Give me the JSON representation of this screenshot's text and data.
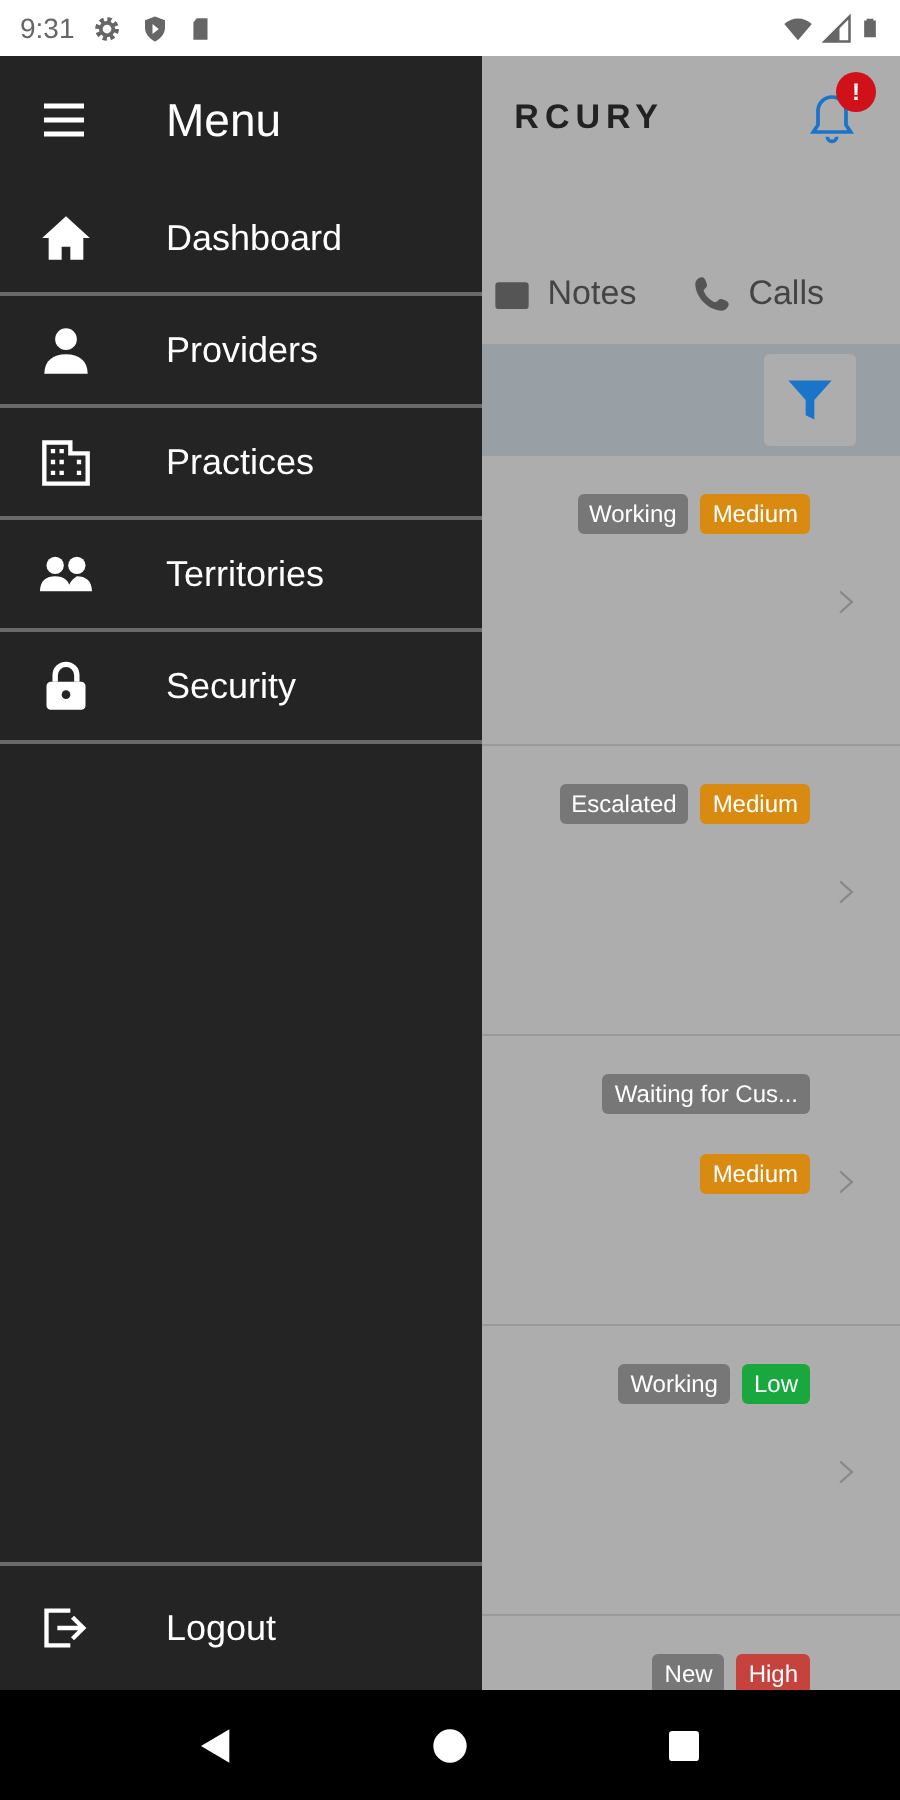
{
  "status_bar": {
    "time": "9:31"
  },
  "drawer": {
    "title": "Menu",
    "items": [
      {
        "label": "Dashboard"
      },
      {
        "label": "Providers"
      },
      {
        "label": "Practices"
      },
      {
        "label": "Territories"
      },
      {
        "label": "Security"
      }
    ],
    "footer_item": {
      "label": "Logout"
    }
  },
  "app": {
    "logo": "RCURY",
    "notification_badge": "!",
    "tabs": [
      {
        "label": "Notes"
      },
      {
        "label": "Calls"
      }
    ],
    "issues": [
      {
        "badges": [
          {
            "text": "Working",
            "color": "#777777"
          },
          {
            "text": "Medium",
            "color": "#d98a10"
          }
        ],
        "chevron": true
      },
      {
        "badges": [
          {
            "text": "Escalated",
            "color": "#777777"
          },
          {
            "text": "Medium",
            "color": "#d98a10"
          }
        ],
        "chevron": true
      },
      {
        "badges": [
          {
            "text": "Waiting for Cus...",
            "color": "#777777"
          },
          {
            "text": "Medium",
            "color": "#d98a10"
          }
        ],
        "chevron": true
      },
      {
        "badges": [
          {
            "text": "Working",
            "color": "#777777"
          },
          {
            "text": "Low",
            "color": "#18a83e"
          }
        ],
        "chevron": true
      },
      {
        "badges": [
          {
            "text": "New",
            "color": "#777777"
          },
          {
            "text": "High",
            "color": "#c6433d"
          }
        ]
      }
    ]
  }
}
